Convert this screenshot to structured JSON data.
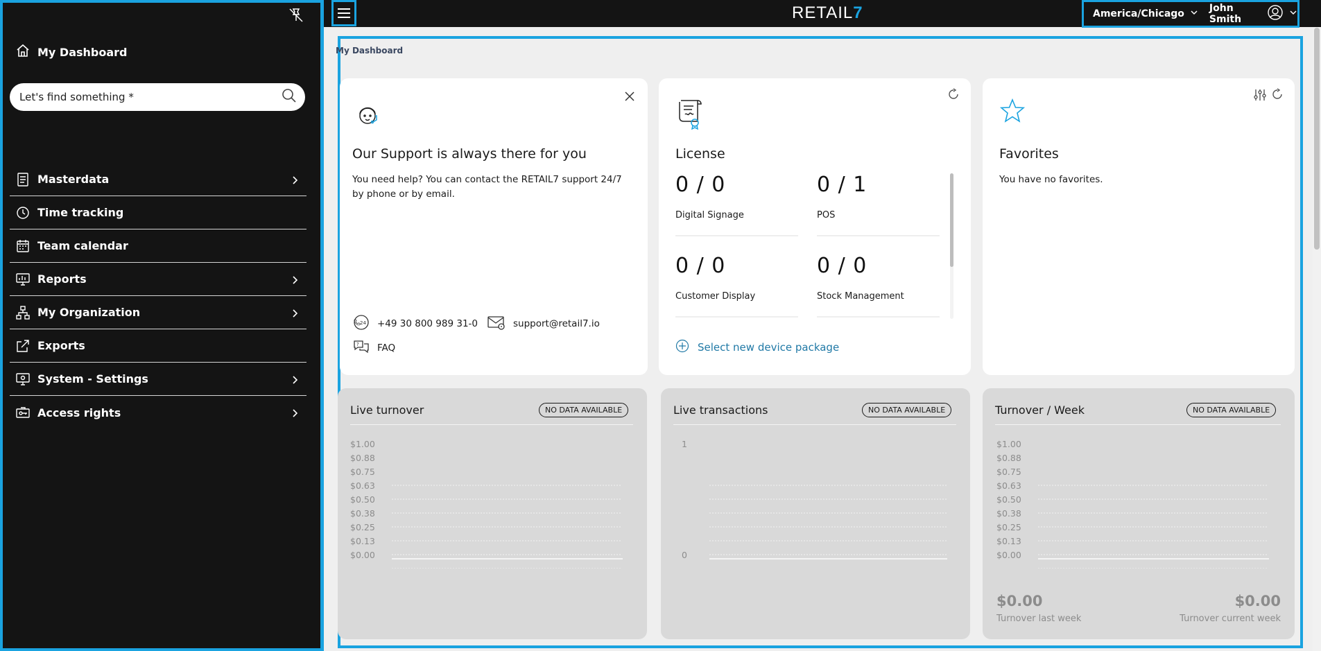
{
  "app": {
    "logo_text": "RETAIL",
    "logo_seven": "7",
    "brand_color": "#1aa3e0"
  },
  "header": {
    "timezone": "America/Chicago",
    "user_name": "John Smith"
  },
  "sidebar": {
    "home_label": "My Dashboard",
    "search_placeholder": "Let's find something *",
    "items": [
      {
        "label": "Masterdata",
        "icon": "document-icon",
        "has_children": true
      },
      {
        "label": "Time tracking",
        "icon": "clock-icon",
        "has_children": false
      },
      {
        "label": "Team calendar",
        "icon": "calendar-icon",
        "has_children": false
      },
      {
        "label": "Reports",
        "icon": "chart-monitor-icon",
        "has_children": true
      },
      {
        "label": "My Organization",
        "icon": "org-chart-icon",
        "has_children": true
      },
      {
        "label": "Exports",
        "icon": "export-icon",
        "has_children": false
      },
      {
        "label": "System - Settings",
        "icon": "settings-monitor-icon",
        "has_children": true
      },
      {
        "label": "Access rights",
        "icon": "key-card-icon",
        "has_children": true
      }
    ]
  },
  "breadcrumb": "My Dashboard",
  "support": {
    "title": "Our Support is always there for you",
    "text": "You need help? You can contact the RETAIL7 support 24/7 by phone or by email.",
    "phone": "+49 30 800 989 31-0",
    "email": "support@retail7.io",
    "faq": "FAQ"
  },
  "license": {
    "title": "License",
    "items": [
      {
        "value": "0 / 0",
        "label": "Digital Signage"
      },
      {
        "value": "0 / 1",
        "label": "POS"
      },
      {
        "value": "0 / 0",
        "label": "Customer Display"
      },
      {
        "value": "0 / 0",
        "label": "Stock Management"
      }
    ],
    "select_label": "Select new device package"
  },
  "favorites": {
    "title": "Favorites",
    "empty_text": "You have no favorites."
  },
  "widgets": {
    "live_turnover": {
      "title": "Live turnover",
      "badge": "NO DATA AVAILABLE",
      "y_ticks": [
        "$1.00",
        "$0.88",
        "$0.75",
        "$0.63",
        "$0.50",
        "$0.38",
        "$0.25",
        "$0.13",
        "$0.00"
      ]
    },
    "live_transactions": {
      "title": "Live transactions",
      "badge": "NO DATA AVAILABLE",
      "y_ticks": [
        "1",
        "0"
      ]
    },
    "turnover_week": {
      "title": "Turnover / Week",
      "badge": "NO DATA AVAILABLE",
      "y_ticks": [
        "$1.00",
        "$0.88",
        "$0.75",
        "$0.63",
        "$0.50",
        "$0.38",
        "$0.25",
        "$0.13",
        "$0.00"
      ],
      "last_week_value": "$0.00",
      "last_week_label": "Turnover last week",
      "current_week_value": "$0.00",
      "current_week_label": "Turnover current week"
    }
  }
}
